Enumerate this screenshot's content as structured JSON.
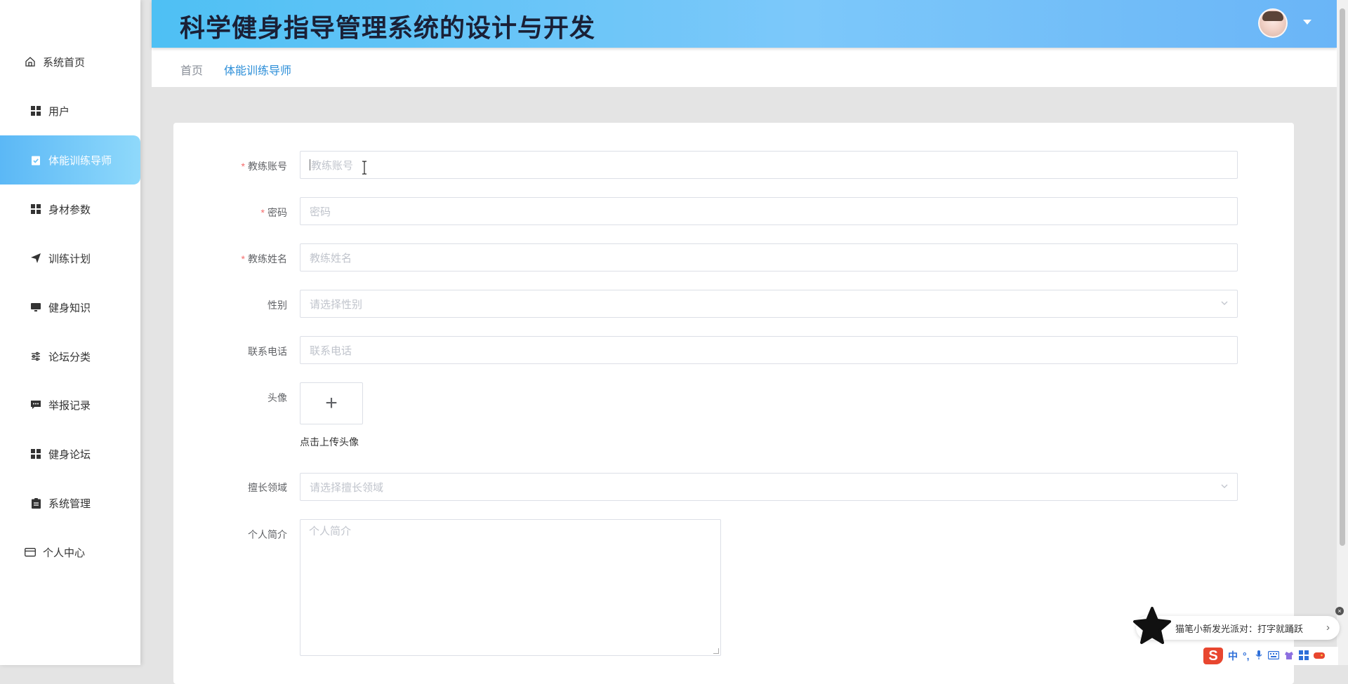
{
  "header": {
    "title": "科学健身指导管理系统的设计与开发"
  },
  "breadcrumb": {
    "home": "首页",
    "current": "体能训练导师"
  },
  "sidebar": {
    "items": [
      {
        "label": "系统首页",
        "icon": "home-icon"
      },
      {
        "label": "用户",
        "icon": "grid-icon"
      },
      {
        "label": "体能训练导师",
        "icon": "clipboard-check-icon",
        "active": true
      },
      {
        "label": "身材参数",
        "icon": "grid-icon"
      },
      {
        "label": "训练计划",
        "icon": "paper-plane-icon"
      },
      {
        "label": "健身知识",
        "icon": "monitor-icon"
      },
      {
        "label": "论坛分类",
        "icon": "sliders-icon"
      },
      {
        "label": "举报记录",
        "icon": "message-icon"
      },
      {
        "label": "健身论坛",
        "icon": "grid-icon"
      },
      {
        "label": "系统管理",
        "icon": "clipboard-icon"
      },
      {
        "label": "个人中心",
        "icon": "card-icon"
      }
    ]
  },
  "form": {
    "account": {
      "label": "教练账号",
      "placeholder": "教练账号",
      "required": true
    },
    "password": {
      "label": "密码",
      "placeholder": "密码",
      "required": true
    },
    "name": {
      "label": "教练姓名",
      "placeholder": "教练姓名",
      "required": true
    },
    "gender": {
      "label": "性别",
      "placeholder": "请选择性别"
    },
    "phone": {
      "label": "联系电话",
      "placeholder": "联系电话"
    },
    "avatar": {
      "label": "头像",
      "upload_symbol": "+",
      "hint": "点击上传头像"
    },
    "specialty": {
      "label": "擅长领域",
      "placeholder": "请选择擅长领域"
    },
    "bio": {
      "label": "个人简介",
      "placeholder": "个人简介"
    }
  },
  "ime": {
    "popup_text": "猫笔小新发光派对：打字就踊跃",
    "mode": "中",
    "punct": "°,",
    "close": "×",
    "arrow": "›"
  }
}
